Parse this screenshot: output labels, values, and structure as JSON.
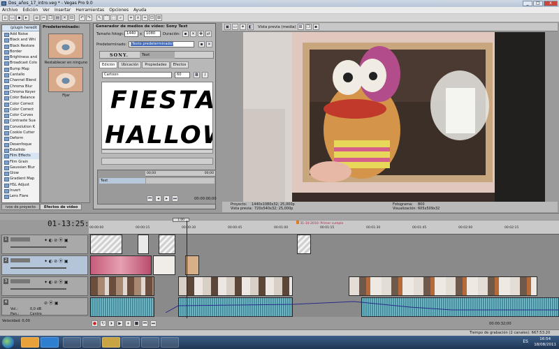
{
  "window": {
    "title": "Dos_años_17_intro.veg * - Vegas Pro 9.0",
    "win_min": "_",
    "win_max": "□",
    "win_close": "x"
  },
  "menu": [
    "Archivo",
    "Edición",
    "Ver",
    "Insertar",
    "Herramientas",
    "Opciones",
    "Ayuda"
  ],
  "fx_list": {
    "header": "(plugin heredit",
    "items": [
      "Add Noise",
      "Black and Whi",
      "Black Restore",
      "Border",
      "Brightness and",
      "Broadcast Colo",
      "Bump Map",
      "Cantallo",
      "Channel Blend",
      "Chroma Blur",
      "Chroma Keyer",
      "Color Balance",
      "Color Correct",
      "Color Correct",
      "Color Curves",
      "Contraste Sua",
      "Convolution K",
      "Cookie Cutter",
      "Deform",
      "Desenfoque",
      "Estallido",
      "Film Effects",
      "Film Grain",
      "Gaussian Blur",
      "Glow",
      "Gradient Map",
      "HSL Adjust",
      "Invert",
      "Lens Flare"
    ],
    "selected_index": 21
  },
  "presets": {
    "title": "Predeterminado:",
    "thumb1_caption": "Restablecer en ninguno",
    "thumb2_caption": "Fijar"
  },
  "left_tabs": [
    "ivos de proyecto",
    "Efectos de vídeo"
  ],
  "generator": {
    "title": "Generador de medios de vídeo: Sony Text",
    "size_label": "Tamaño fotogr.:",
    "width": "1440",
    "x_sep": "x",
    "height": "1080",
    "duration_label": "Duración:",
    "preset_label": "Predeterminado:",
    "preset_value": "(Texto predeterminado)",
    "brand": "SONY.",
    "plugin_tab": "Text",
    "tabs": [
      "Edición",
      "Ubicación",
      "Propiedades",
      "Efectos"
    ],
    "font": "Cartoon",
    "font_size": "60",
    "bold": "B",
    "italic": "I",
    "line1": "FIESTA",
    "line2": "HALLOW",
    "key_rows": [
      "Text"
    ],
    "ruler_start": "00:00:00;00",
    "ruler_end": "00:00:00;00",
    "ruler_left": "00;00",
    "ruler_right": "00;00"
  },
  "preview": {
    "mode": "Vista previa (media)",
    "project_label": "Proyecto:",
    "project_value": "1440x1080x32; 25,000p",
    "preview_label": "Vista previa:",
    "preview_value": "720x540x32; 25,000p",
    "frame_label": "Fotograma:",
    "frame_value": "800",
    "display_label": "Visualización:",
    "display_value": "605x509x32"
  },
  "timeline": {
    "timecode": "01-13:25:33",
    "ruler_ticks": [
      "00:00:00",
      "00:00:15",
      "00:00:30",
      "00:00:45",
      "00:01:00",
      "00:01:15",
      "00:01:30",
      "00:01:45",
      "00:02:00",
      "00:02:15"
    ],
    "marker_label": "31-10-2010: Primer cumple",
    "cursor_label": "1:00",
    "tracks": [
      {
        "num": "1"
      },
      {
        "num": "2"
      },
      {
        "num": "3"
      },
      {
        "num": "4",
        "vol_label": "Vol.:",
        "vol_value": "0,0 dB",
        "pan_label": "Pan.:",
        "pan_value": "Centro"
      }
    ],
    "rate_label": "Velocidad: 0,00",
    "end_time": "00:00:32;00"
  },
  "status": {
    "record_time": "Tiempo de grabación (2 canales): 667:53:20"
  },
  "taskbar": {
    "time": "16:54",
    "date": "18/08/2011",
    "lang": "ES"
  },
  "colors": {
    "accent_selection": "#3c66b8",
    "timeline_bg": "#8a8a8a"
  }
}
